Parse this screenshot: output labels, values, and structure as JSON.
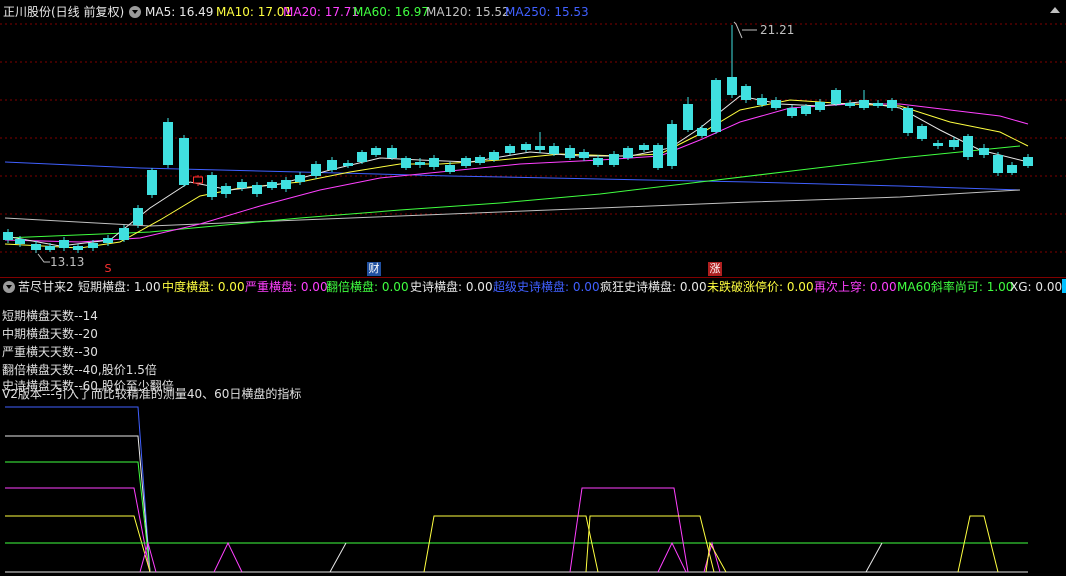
{
  "header": {
    "stock_title": "正川股份(日线 前复权)",
    "ma": [
      {
        "label": "MA5: 16.49",
        "color": "#e8e8e8"
      },
      {
        "label": "MA10: 17.01",
        "color": "#ffff40"
      },
      {
        "label": "MA20: 17.71",
        "color": "#ff40ff"
      },
      {
        "label": "MA60: 16.97",
        "color": "#40ff40"
      },
      {
        "label": "MA120: 15.52",
        "color": "#c0c0c0"
      },
      {
        "label": "MA250: 15.53",
        "color": "#4060ff"
      }
    ]
  },
  "price_chart": {
    "high_label": "21.21",
    "low_label": "13.13",
    "markers": [
      {
        "text": "S",
        "color": "#ff3030",
        "bg": "none"
      },
      {
        "text": "财",
        "color": "#ffffff",
        "bg": "#2050a0"
      },
      {
        "text": "涨",
        "color": "#ffffff",
        "bg": "#b02020"
      }
    ]
  },
  "indicator_bar": {
    "name": "苦尽甘来2",
    "items": [
      {
        "label": "短期横盘: 1.00",
        "color": "#e8e8e8"
      },
      {
        "label": "中度横盘: 0.00",
        "color": "#ffff40"
      },
      {
        "label": "严重横盘: 0.00",
        "color": "#ff40ff"
      },
      {
        "label": "翻倍横盘: 0.00",
        "color": "#40ff40"
      },
      {
        "label": "史诗横盘: 0.00",
        "color": "#e8e8e8"
      },
      {
        "label": "超级史诗横盘: 0.00",
        "color": "#4060ff"
      },
      {
        "label": "疯狂史诗横盘: 0.00",
        "color": "#e8e8e8"
      },
      {
        "label": "未跌破涨停价: 0.00",
        "color": "#ffff40"
      },
      {
        "label": "再次上穿: 0.00",
        "color": "#ff40ff"
      },
      {
        "label": "MA60斜率尚可: 1.00",
        "color": "#40ff40"
      },
      {
        "label": "XG: 0.00",
        "color": "#e8e8e8"
      }
    ]
  },
  "notes": [
    "短期横盘天数--14",
    "中期横盘天数--20",
    "严重横天天数--30",
    "翻倍横盘天数--40,股价1.5倍",
    "史诗横盘天数--60,股价至少翻倍",
    "V2版本---引入了而比较精准的测量40、60日横盘的指标"
  ],
  "colors": {
    "up": "#ff3030",
    "down": "#40e0e0",
    "grid": "#800000"
  }
}
